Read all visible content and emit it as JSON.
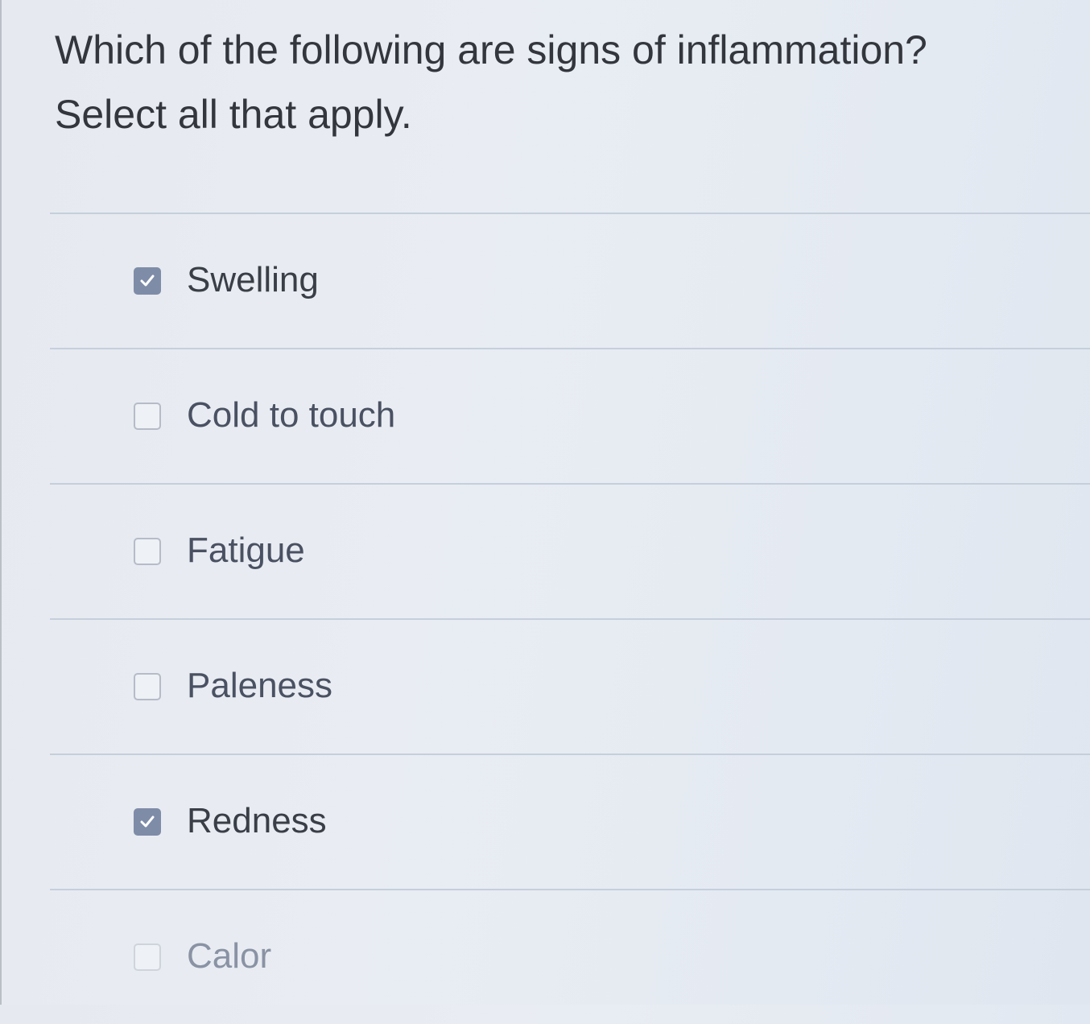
{
  "question": {
    "line1": "Which of the following are signs of inflammation?",
    "line2": "Select all that apply."
  },
  "options": [
    {
      "label": "Swelling",
      "checked": true
    },
    {
      "label": "Cold to touch",
      "checked": false
    },
    {
      "label": "Fatigue",
      "checked": false
    },
    {
      "label": "Paleness",
      "checked": false
    },
    {
      "label": "Redness",
      "checked": true
    },
    {
      "label": "Calor",
      "checked": false
    }
  ],
  "colors": {
    "checked_fill": "#7e8ca8",
    "divider": "#c5cfdc",
    "text": "#3a3e47"
  }
}
